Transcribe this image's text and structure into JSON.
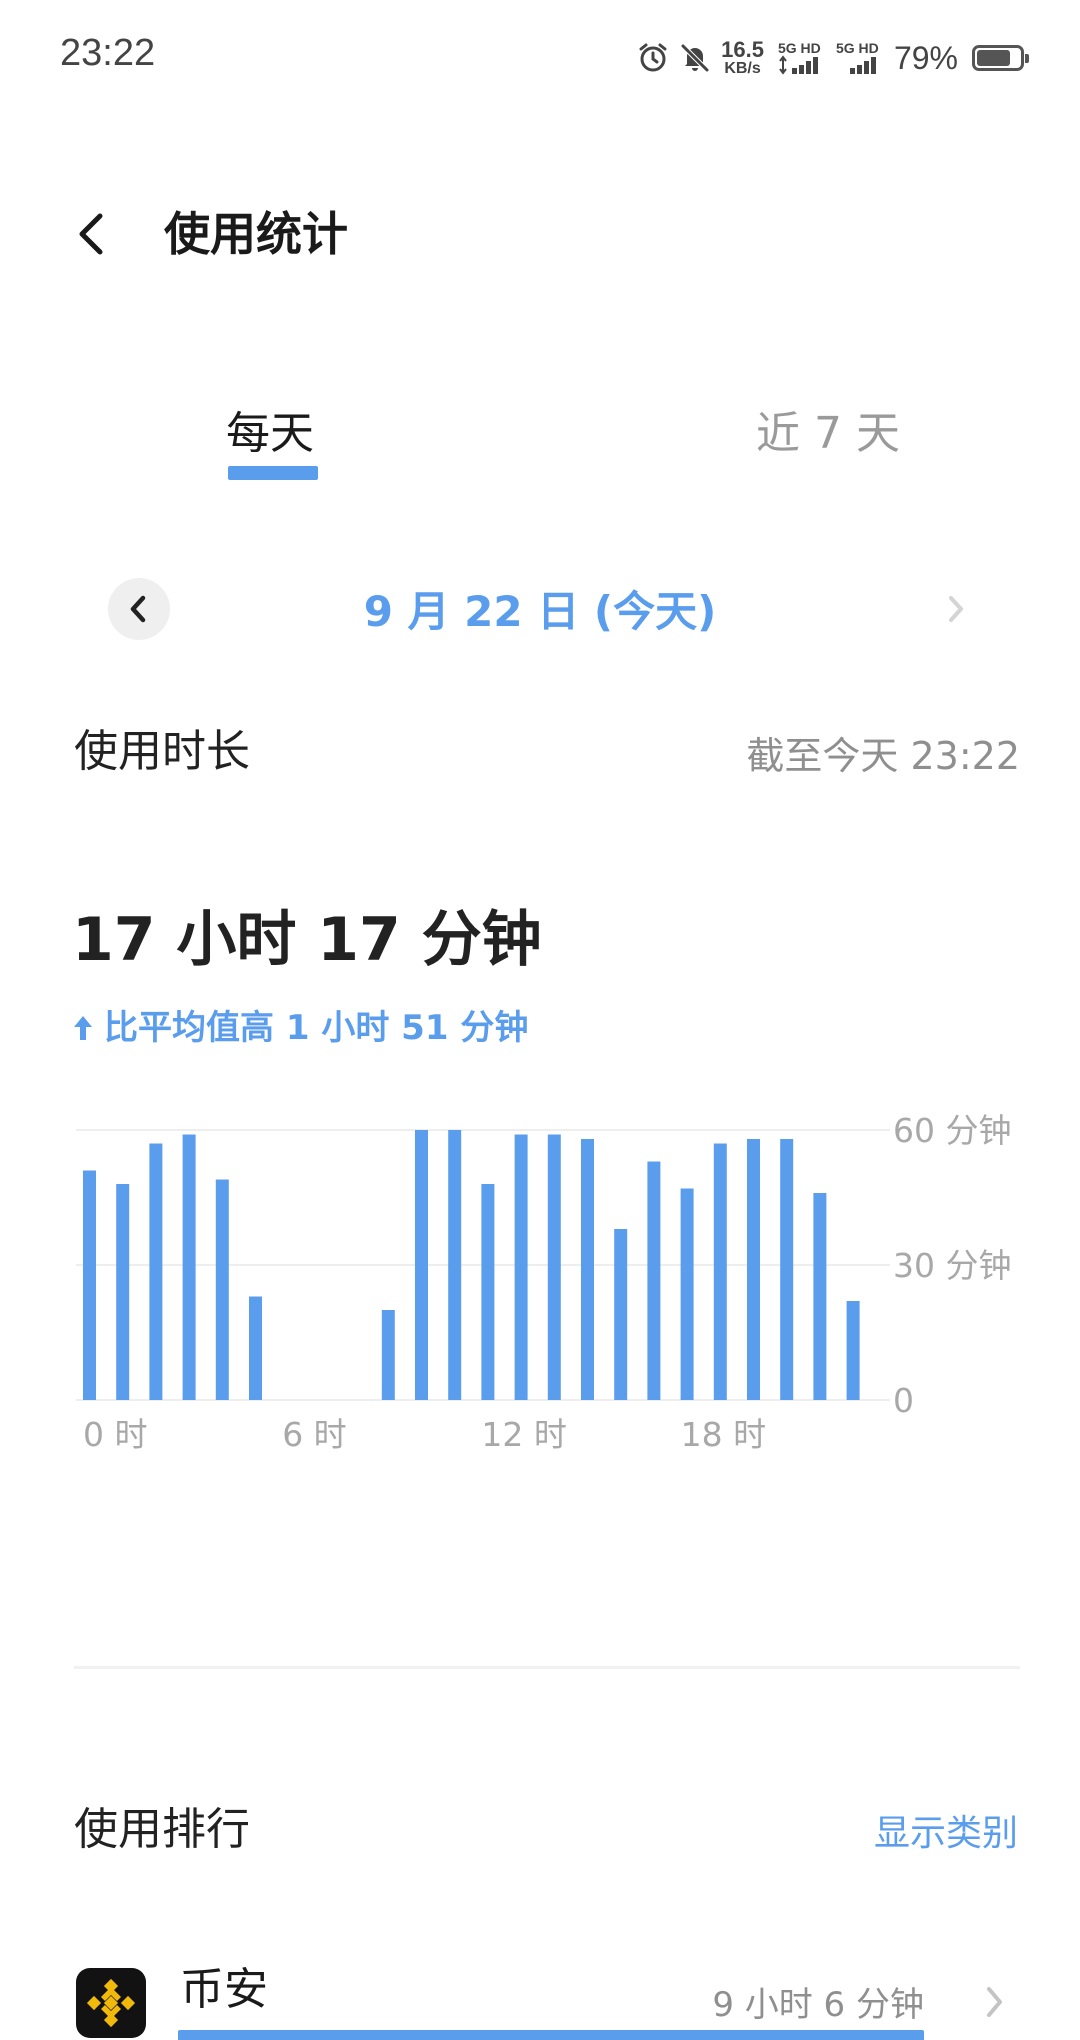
{
  "status_bar": {
    "time": "23:22",
    "net_speed_value": "16.5",
    "net_speed_unit": "KB/s",
    "sim1_label": "5G HD",
    "sim2_label": "5G HD",
    "battery_text": "79%",
    "battery_level": 0.79,
    "icons": [
      "alarm-icon",
      "mute-bell-icon",
      "signal-icon",
      "battery-icon"
    ]
  },
  "header": {
    "title": "使用统计"
  },
  "tabs": [
    {
      "label": "每天",
      "active": true
    },
    {
      "label": "近 7 天",
      "active": false
    }
  ],
  "date_nav": {
    "label": "9 月 22 日 (今天)"
  },
  "usage": {
    "title": "使用时长",
    "as_of": "截至今天 23:22",
    "total": "17 小时 17 分钟",
    "compare": "比平均值高 1 小时 51 分钟"
  },
  "chart_data": {
    "type": "bar",
    "categories": [
      "0",
      "1",
      "2",
      "3",
      "4",
      "5",
      "6",
      "7",
      "8",
      "9",
      "10",
      "11",
      "12",
      "13",
      "14",
      "15",
      "16",
      "17",
      "18",
      "19",
      "20",
      "21",
      "22",
      "23"
    ],
    "values": [
      51,
      48,
      57,
      59,
      49,
      23,
      0,
      0,
      0,
      20,
      60,
      60,
      48,
      59,
      59,
      58,
      38,
      53,
      47,
      57,
      58,
      58,
      46,
      22
    ],
    "x_tick_labels": [
      {
        "index": 0,
        "label": "0 时"
      },
      {
        "index": 6,
        "label": "6 时"
      },
      {
        "index": 12,
        "label": "12 时"
      },
      {
        "index": 18,
        "label": "18 时"
      }
    ],
    "y_ticks": [
      {
        "value": 60,
        "label": "60 分钟"
      },
      {
        "value": 30,
        "label": "30 分钟"
      },
      {
        "value": 0,
        "label": "0"
      }
    ],
    "ylim": [
      0,
      60
    ],
    "grid": true,
    "bar_color": "#5b9ded"
  },
  "ranking": {
    "title": "使用排行",
    "toggle_label": "显示类别",
    "apps": [
      {
        "name": "币安",
        "duration": "9 小时 6 分钟",
        "usage_fraction": 1.0,
        "icon": "binance-icon"
      }
    ]
  },
  "colors": {
    "accent": "#5b9ded",
    "secondary_text": "#8f8f8f"
  }
}
